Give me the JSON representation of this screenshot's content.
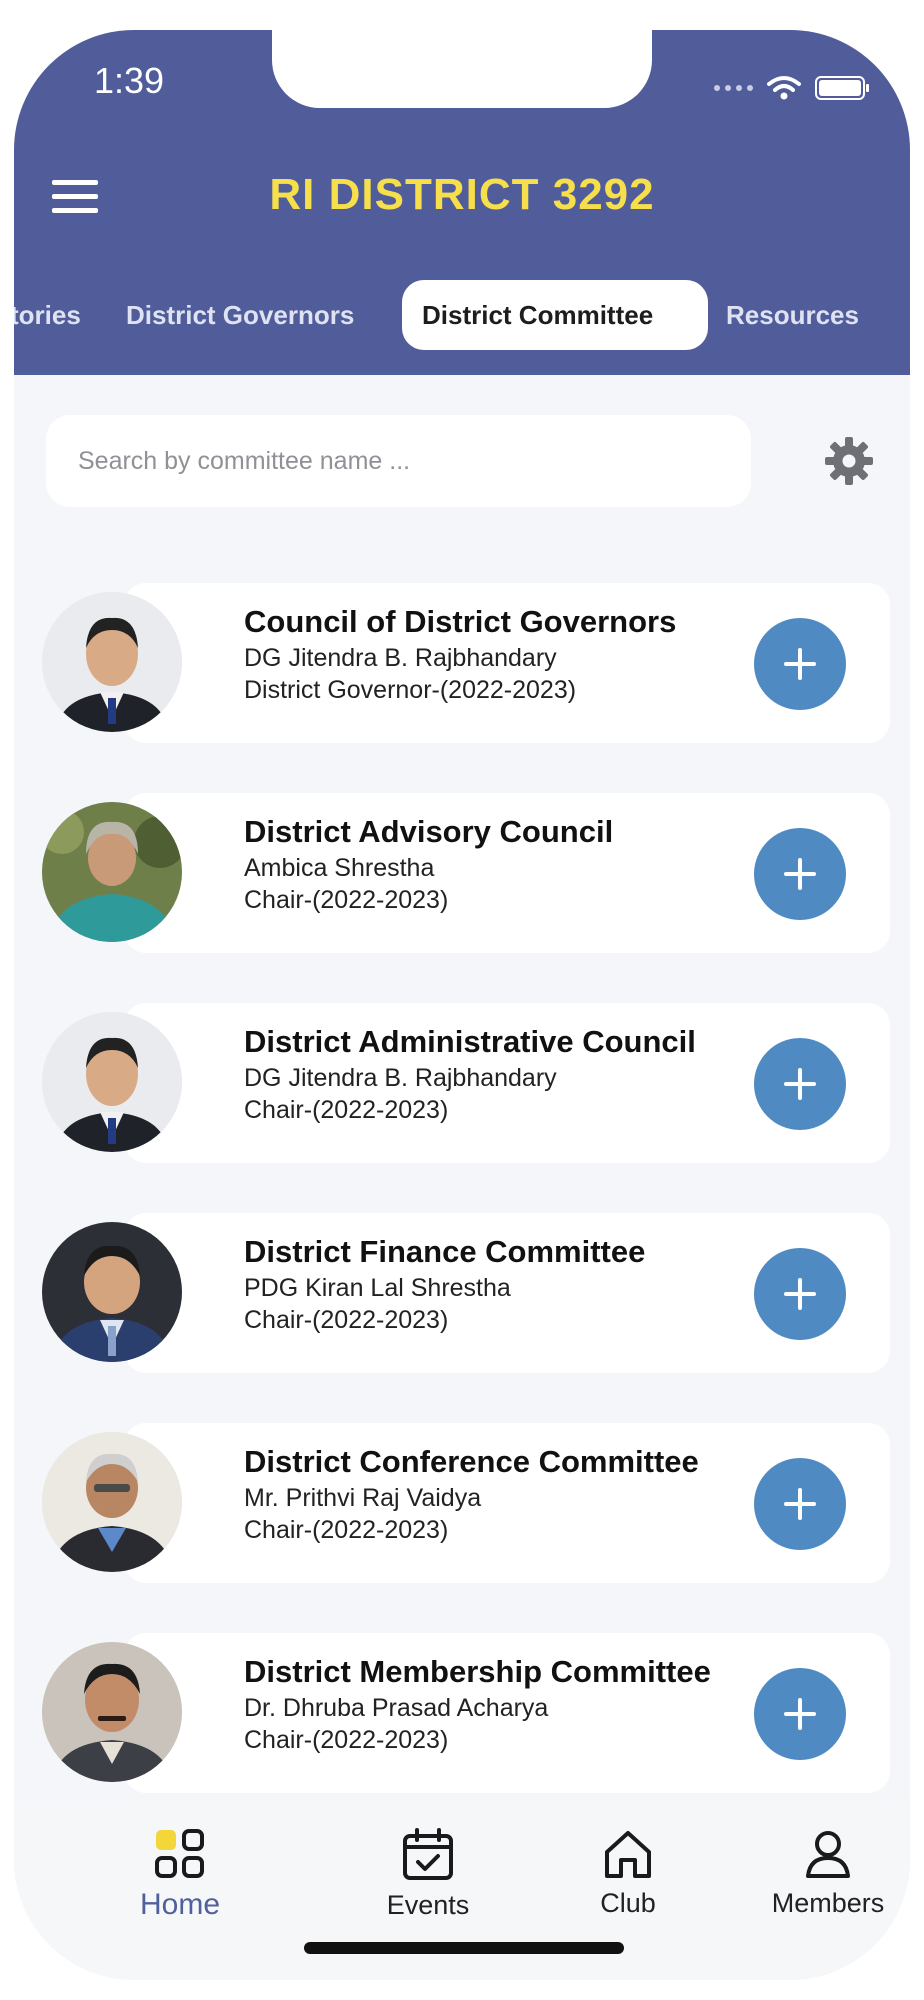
{
  "status": {
    "time": "1:39"
  },
  "app": {
    "title": "RI DISTRICT 3292"
  },
  "tabs": [
    {
      "label": "tories"
    },
    {
      "label": "District Governors"
    },
    {
      "label": "District Committee",
      "active": true
    },
    {
      "label": "Resources"
    }
  ],
  "search": {
    "placeholder": "Search by committee name ..."
  },
  "committees": [
    {
      "title": "Council of District Governors",
      "name": "DG Jitendra B. Rajbhandary",
      "role": "District Governor-(2022-2023)"
    },
    {
      "title": "District Advisory Council",
      "name": "Ambica  Shrestha",
      "role": "Chair-(2022-2023)"
    },
    {
      "title": "District Administrative Council",
      "name": "DG Jitendra B. Rajbhandary",
      "role": "Chair-(2022-2023)"
    },
    {
      "title": "District Finance Committee",
      "name": "PDG Kiran Lal Shrestha",
      "role": "Chair-(2022-2023)"
    },
    {
      "title": "District Conference Committee",
      "name": "Mr. Prithvi Raj Vaidya",
      "role": "Chair-(2022-2023)"
    },
    {
      "title": "District Membership Committee",
      "name": "Dr. Dhruba Prasad Acharya",
      "role": "Chair-(2022-2023)"
    }
  ],
  "bottom_nav": {
    "home": "Home",
    "events": "Events",
    "club": "Club",
    "members": "Members"
  },
  "colors": {
    "header": "#505d9a",
    "title": "#f6df4a",
    "accent_button": "#4f8ac3",
    "active_nav": "#50609b",
    "home_icon_highlight": "#f2d63a"
  }
}
